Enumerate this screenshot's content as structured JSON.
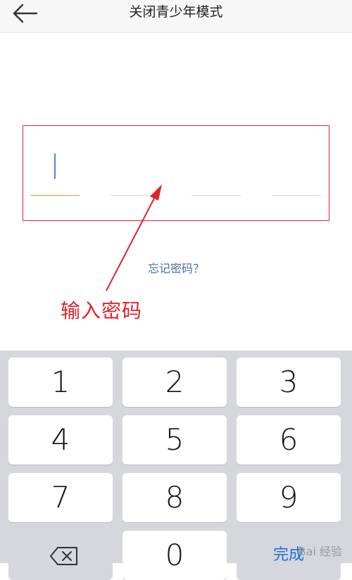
{
  "header": {
    "title": "关闭青少年模式",
    "back_icon": "arrow-left-icon"
  },
  "pin": {
    "slots": 4,
    "filled": 0
  },
  "forgot_link": "忘记密码？",
  "annotation": {
    "text": "输入密码",
    "color": "#e0232b"
  },
  "keypad": {
    "keys": [
      "1",
      "2",
      "3",
      "4",
      "5",
      "6",
      "7",
      "8",
      "9",
      "",
      "0",
      "完成"
    ],
    "backspace_icon": "backspace-icon",
    "done_color": "#1f6fd6"
  },
  "watermark": {
    "text": "Bai 经验"
  }
}
